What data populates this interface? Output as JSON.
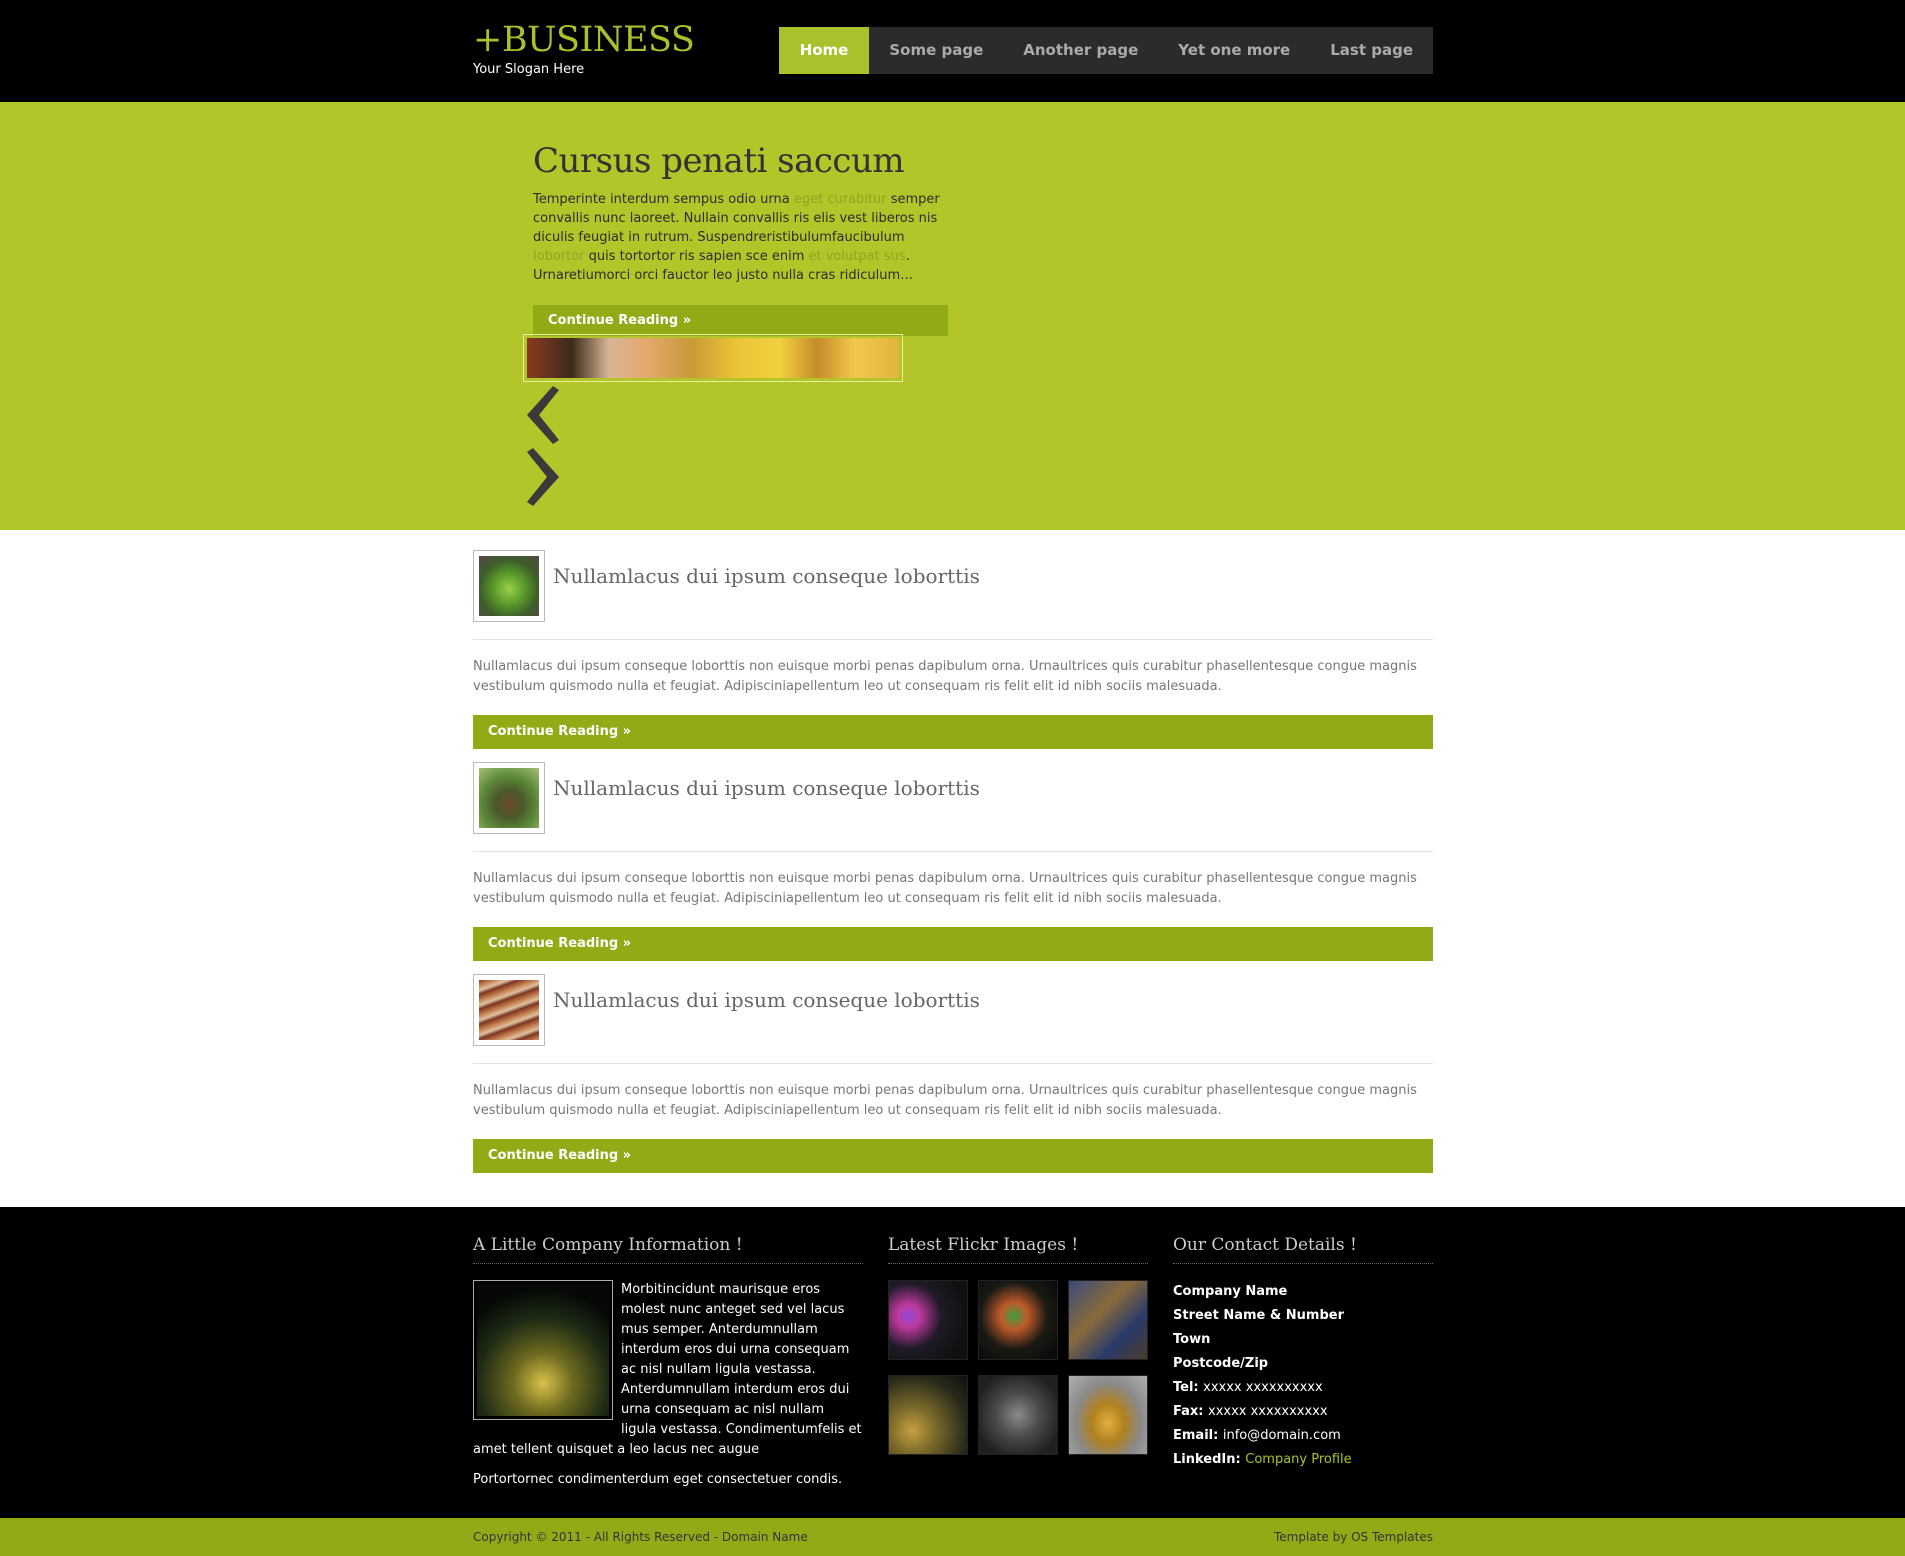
{
  "header": {
    "site_title": "+BUSINESS",
    "slogan": "Your Slogan Here",
    "nav": [
      "Home",
      "Some page",
      "Another page",
      "Yet one more",
      "Last page"
    ],
    "active_nav": "Home"
  },
  "featured": {
    "title": "Cursus penati saccum",
    "text_1": "Temperinte interdum sempus odio urna ",
    "link_1": "eget curabitur",
    "text_2": " semper convallis nunc laoreet. Nullain convallis ris elis vest liberos nis diculis feugiat in rutrum. Suspendreristibulumfaucibulum ",
    "link_2": "lobortor",
    "text_3": " quis tortortor ris sapien sce enim ",
    "link_3": "et volutpat sus",
    "text_4": ". Urnaretiumorci orci fauctor leo justo nulla cras ridiculum…",
    "more": "Continue Reading »",
    "prev_icon": "chevron-left-icon",
    "next_icon": "chevron-right-icon"
  },
  "posts": [
    {
      "title": "Nullamlacus dui ipsum conseque loborttis",
      "text": "Nullamlacus dui ipsum conseque loborttis non euisque morbi penas dapibulum orna. Urnaultrices quis curabitur phasellentesque congue magnis vestibulum quismodo nulla et feugiat. Adipisciniapellentum leo ut consequam ris felit elit id nibh sociis malesuada.",
      "more": "Continue Reading »"
    },
    {
      "title": "Nullamlacus dui ipsum conseque loborttis",
      "text": "Nullamlacus dui ipsum conseque loborttis non euisque morbi penas dapibulum orna. Urnaultrices quis curabitur phasellentesque congue magnis vestibulum quismodo nulla et feugiat. Adipisciniapellentum leo ut consequam ris felit elit id nibh sociis malesuada.",
      "more": "Continue Reading »"
    },
    {
      "title": "Nullamlacus dui ipsum conseque loborttis",
      "text": "Nullamlacus dui ipsum conseque loborttis non euisque morbi penas dapibulum orna. Urnaultrices quis curabitur phasellentesque congue magnis vestibulum quismodo nulla et feugiat. Adipisciniapellentum leo ut consequam ris felit elit id nibh sociis malesuada.",
      "more": "Continue Reading »"
    }
  ],
  "footer": {
    "company": {
      "heading": "A Little Company Information !",
      "text": "Morbitincidunt maurisque eros molest nunc anteget sed vel lacus mus semper. Anterdumnullam interdum eros dui urna consequam ac nisl nullam ligula vestassa. Anterdumnullam interdum eros dui urna consequam ac nisl nullam ligula vestassa. Condimentumfelis et amet tellent quisquet a leo lacus nec augue",
      "text_2": "Portortornec condimenterdum eget consectetuer condis."
    },
    "flickr": {
      "heading": "Latest Flickr Images !"
    },
    "contact": {
      "heading": "Our Contact Details !",
      "company_name": "Company Name",
      "street": "Street Name & Number",
      "town": "Town",
      "postcode": "Postcode/Zip",
      "tel_label": "Tel:",
      "tel_value": "xxxxx xxxxxxxxxx",
      "fax_label": "Fax:",
      "fax_value": "xxxxx xxxxxxxxxx",
      "email_label": "Email:",
      "email_value": "info@domain.com",
      "linkedin_label": "LinkedIn:",
      "linkedin_value": "Company Profile"
    }
  },
  "copyright": {
    "left": "Copyright © 2011 - All Rights Reserved - Domain Name",
    "right": "Template by OS Templates"
  },
  "colors": {
    "accent": "#a9c12a",
    "featured_bg": "#b2c529",
    "button": "#93aa17",
    "dark": "#000000"
  }
}
